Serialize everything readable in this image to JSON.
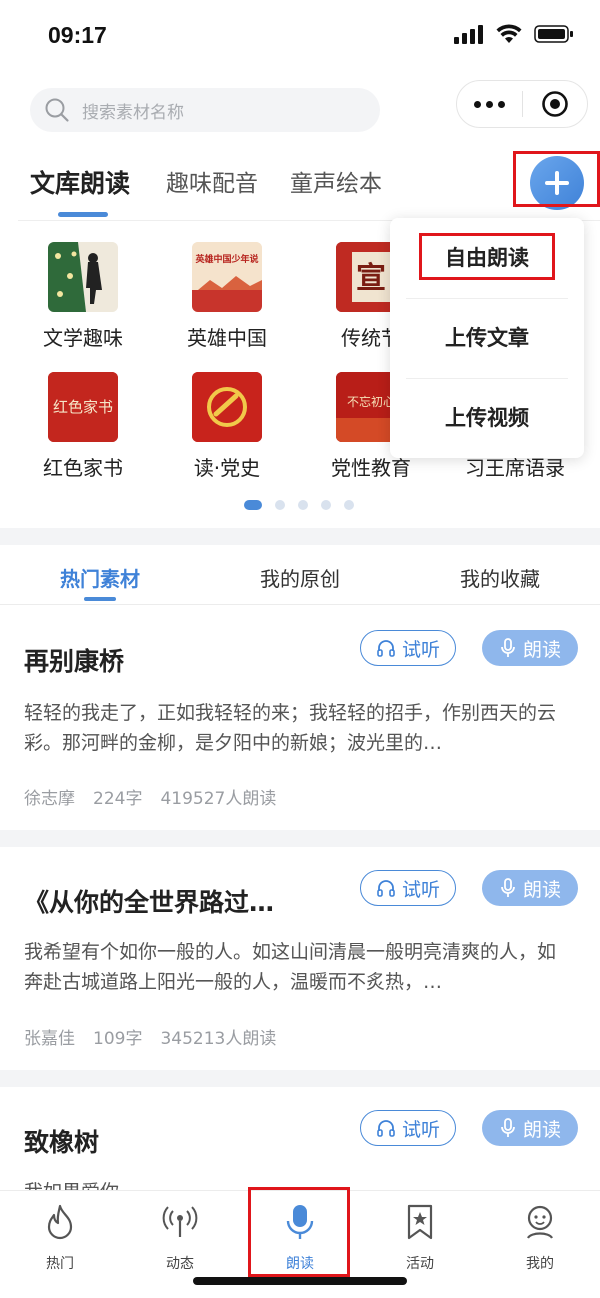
{
  "status": {
    "time": "09:17"
  },
  "search": {
    "placeholder": "搜索素材名称"
  },
  "top_tabs": [
    "文库朗读",
    "趣味配音",
    "童声绘本"
  ],
  "categories": [
    {
      "label": "文学趣味"
    },
    {
      "label": "英雄中国",
      "thumb_text": "英雄中国少年说"
    },
    {
      "label": "传统节",
      "thumb_text": "宣"
    },
    {
      "label": "红色家书",
      "thumb_text": "红色家书"
    },
    {
      "label": "读·党史"
    },
    {
      "label": "党性教育",
      "thumb_text": "不忘初心"
    },
    {
      "label": "习王席语录"
    }
  ],
  "dropdown": {
    "items": [
      "自由朗读",
      "上传文章",
      "上传视频"
    ]
  },
  "sub_tabs": [
    "热门素材",
    "我的原创",
    "我的收藏"
  ],
  "buttons": {
    "listen": "试听",
    "read": "朗读"
  },
  "materials": [
    {
      "title": "再别康桥",
      "excerpt": "轻轻的我走了，正如我轻轻的来；我轻轻的招手，作别西天的云彩。那河畔的金柳，是夕阳中的新娘；波光里的…",
      "author": "徐志摩",
      "words": "224字",
      "reads": "419527人朗读"
    },
    {
      "title": "《从你的全世界路过…",
      "excerpt": "我希望有个如你一般的人。如这山间清晨一般明亮清爽的人，如奔赴古城道路上阳光一般的人，温暖而不炙热，…",
      "author": "张嘉佳",
      "words": "109字",
      "reads": "345213人朗读"
    },
    {
      "title": "致橡树",
      "excerpt": "我如果爱你——"
    }
  ],
  "tabbar": [
    "热门",
    "动态",
    "朗读",
    "活动",
    "我的"
  ],
  "colors": {
    "accent": "#4a8ad8",
    "highlight_frame": "#e0161b"
  }
}
